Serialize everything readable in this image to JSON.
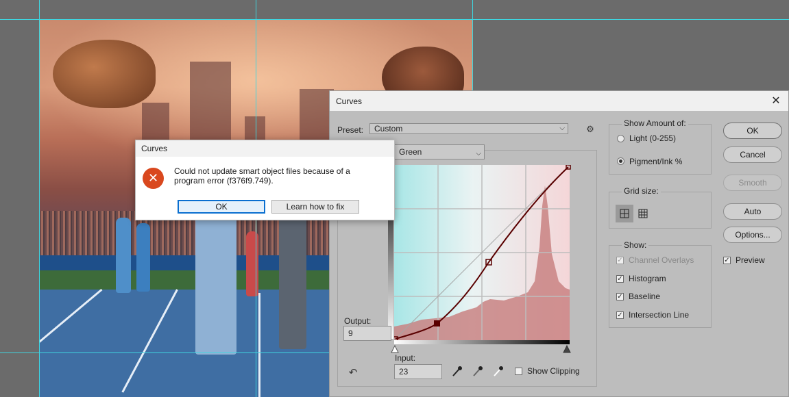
{
  "curves": {
    "title": "Curves",
    "close_glyph": "✕",
    "preset_label": "Preset:",
    "preset_value": "Custom",
    "channel_value": "Green",
    "output_label": "Output:",
    "output_value": "9",
    "input_label": "Input:",
    "input_value": "23",
    "show_clipping_label": "Show Clipping",
    "show_amount_title": "Show Amount of:",
    "light_label": "Light  (0-255)",
    "pigment_label": "Pigment/Ink %",
    "grid_size_title": "Grid size:",
    "show_title": "Show:",
    "channel_overlays_label": "Channel Overlays",
    "histogram_label": "Histogram",
    "baseline_label": "Baseline",
    "intersection_label": "Intersection Line",
    "preview_label": "Preview",
    "buttons": {
      "ok": "OK",
      "cancel": "Cancel",
      "smooth": "Smooth",
      "auto": "Auto",
      "options": "Options..."
    },
    "icons": {
      "gear": "⚙",
      "chevron": "⌵",
      "on_image": "↶"
    }
  },
  "error_dialog": {
    "title": "Curves",
    "message": "Could not update smart object files because of a program error (f376f9.749).",
    "ok_label": "OK",
    "learn_label": "Learn how to fix",
    "icon_glyph": "✕"
  },
  "colors": {
    "dialog_bg": "#bdbdbd",
    "curve": "#5a0000",
    "histogram": "#c98282",
    "guides": "#3fd6e0",
    "error_icon": "#d9481e"
  }
}
